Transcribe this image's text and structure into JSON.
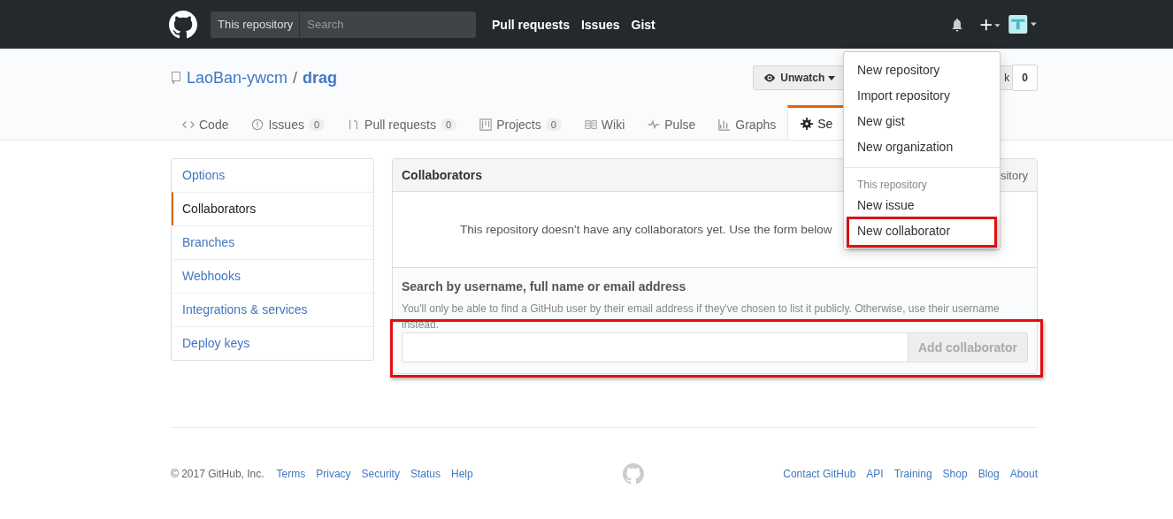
{
  "top_bar": {
    "scope_label": "This repository",
    "search": {
      "placeholder": "Search"
    },
    "links": [
      "Pull requests",
      "Issues",
      "Gist"
    ]
  },
  "repo": {
    "owner": "LaoBan-ywcm",
    "separator": "/",
    "name": "drag",
    "watch_button": "Unwatch",
    "fork_button": "k",
    "fork_count": "0"
  },
  "tabs": [
    {
      "label": "Code",
      "selected": false
    },
    {
      "label": "Issues",
      "count": "0",
      "selected": false
    },
    {
      "label": "Pull requests",
      "count": "0",
      "selected": false
    },
    {
      "label": "Projects",
      "count": "0",
      "selected": false
    },
    {
      "label": "Wiki",
      "selected": false
    },
    {
      "label": "Pulse",
      "selected": false
    },
    {
      "label": "Graphs",
      "selected": false
    },
    {
      "label": "Se",
      "selected": true
    }
  ],
  "sidebar": {
    "items": [
      {
        "label": "Options",
        "selected": false
      },
      {
        "label": "Collaborators",
        "selected": true
      },
      {
        "label": "Branches",
        "selected": false
      },
      {
        "label": "Webhooks",
        "selected": false
      },
      {
        "label": "Integrations & services",
        "selected": false
      },
      {
        "label": "Deploy keys",
        "selected": false
      }
    ]
  },
  "collaborators": {
    "title": "Collaborators",
    "title_right": "sitory",
    "empty_text": "This repository doesn't have any collaborators yet. Use the form below",
    "search_label": "Search by username, full name or email address",
    "note": "You'll only be able to find a GitHub user by their email address if they've chosen to list it publicly. Otherwise, use their username instead.",
    "add_button": "Add collaborator",
    "add_button_disabled": true,
    "highlighted": true
  },
  "new_menu": {
    "items": [
      {
        "label": "New repository",
        "highlighted": false
      },
      {
        "label": "Import repository",
        "highlighted": false
      },
      {
        "label": "New gist",
        "highlighted": false
      },
      {
        "label": "New organization",
        "highlighted": false
      }
    ],
    "section_header": "This repository",
    "section_items": [
      {
        "label": "New issue",
        "highlighted": false
      },
      {
        "label": "New collaborator",
        "highlighted": true
      }
    ]
  },
  "footer": {
    "copyright": "© 2017 GitHub, Inc.",
    "left_links": [
      "Terms",
      "Privacy",
      "Security",
      "Status",
      "Help"
    ],
    "right_links": [
      "Contact GitHub",
      "API",
      "Training",
      "Shop",
      "Blog",
      "About"
    ]
  }
}
